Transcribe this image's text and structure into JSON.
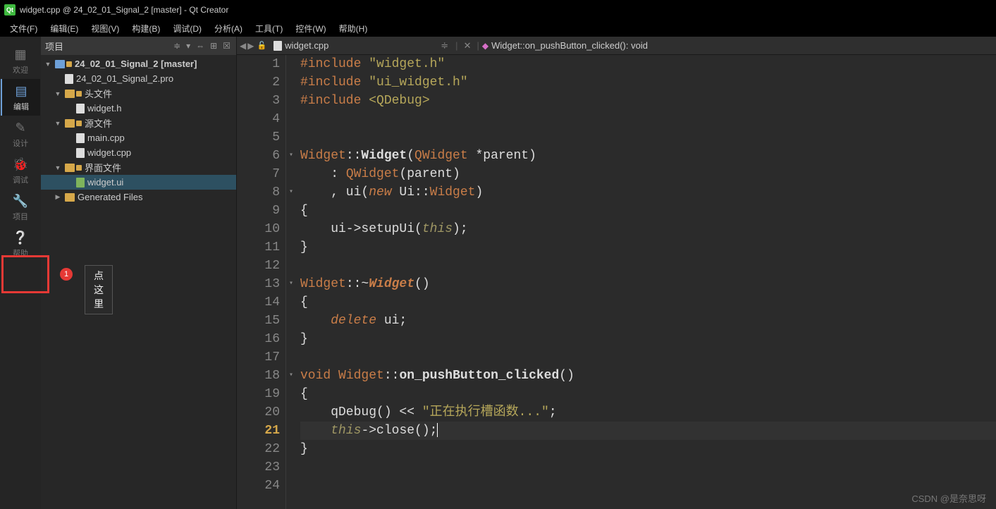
{
  "title": "widget.cpp @ 24_02_01_Signal_2 [master] - Qt Creator",
  "menu": [
    "文件(F)",
    "编辑(E)",
    "视图(V)",
    "构建(B)",
    "调试(D)",
    "分析(A)",
    "工具(T)",
    "控件(W)",
    "帮助(H)"
  ],
  "modes": {
    "welcome": "欢迎",
    "edit": "编辑",
    "design": "设计",
    "debug": "调试",
    "project": "项目",
    "help": "帮助"
  },
  "annotation": {
    "badge": "1",
    "text": "点这里"
  },
  "sidebar": {
    "header": "项目",
    "tree": {
      "root": "24_02_01_Signal_2 [master]",
      "pro": "24_02_01_Signal_2.pro",
      "headers": "头文件",
      "header1": "widget.h",
      "sources": "源文件",
      "source1": "main.cpp",
      "source2": "widget.cpp",
      "forms": "界面文件",
      "form1": "widget.ui",
      "generated": "Generated Files"
    }
  },
  "editor": {
    "filename": "widget.cpp",
    "symbol": "Widget::on_pushButton_clicked(): void"
  },
  "code": {
    "l1a": "#include ",
    "l1b": "\"widget.h\"",
    "l2a": "#include ",
    "l2b": "\"ui_widget.h\"",
    "l3a": "#include ",
    "l3b": "<QDebug>",
    "l6a": "Widget",
    "l6b": "::",
    "l6c": "Widget",
    "l6d": "(",
    "l6e": "QWidget",
    "l6f": " *parent)",
    "l7a": "    : ",
    "l7b": "QWidget",
    "l7c": "(parent)",
    "l8a": "    , ui(",
    "l8b": "new",
    "l8c": " Ui::",
    "l8d": "Widget",
    "l8e": ")",
    "l9": "{",
    "l10a": "    ui->setupUi(",
    "l10b": "this",
    "l10c": ");",
    "l11": "}",
    "l13a": "Widget",
    "l13b": "::~",
    "l13c": "Widget",
    "l13d": "()",
    "l14": "{",
    "l15a": "    ",
    "l15b": "delete",
    "l15c": " ui;",
    "l16": "}",
    "l18a": "void",
    "l18b": " ",
    "l18c": "Widget",
    "l18d": "::",
    "l18e": "on_pushButton_clicked",
    "l18f": "()",
    "l19": "{",
    "l20a": "    qDebug() << ",
    "l20b": "\"正在执行槽函数...\"",
    "l20c": ";",
    "l21a": "    ",
    "l21b": "this",
    "l21c": "->close();",
    "l22": "}"
  },
  "lines": [
    "1",
    "2",
    "3",
    "4",
    "5",
    "6",
    "7",
    "8",
    "9",
    "10",
    "11",
    "12",
    "13",
    "14",
    "15",
    "16",
    "17",
    "18",
    "19",
    "20",
    "21",
    "22",
    "23",
    "24"
  ],
  "folds": {
    "6": "▾",
    "8": "▾",
    "13": "▾",
    "18": "▾"
  },
  "watermark": "CSDN @是奈思呀"
}
